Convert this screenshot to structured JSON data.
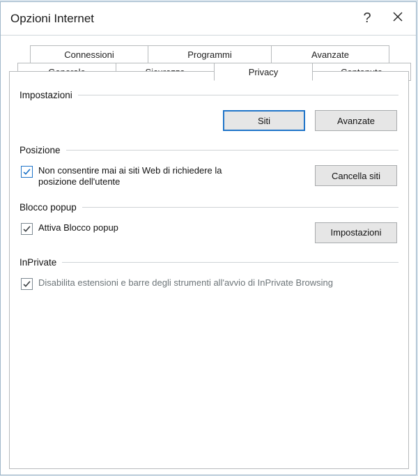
{
  "window": {
    "title": "Opzioni Internet"
  },
  "tabs": {
    "row1": {
      "connections": "Connessioni",
      "programs": "Programmi",
      "advanced": "Avanzate"
    },
    "row2": {
      "general": "Generale",
      "security": "Sicurezza",
      "privacy": "Privacy",
      "content": "Contenuto"
    },
    "active": "privacy"
  },
  "privacy": {
    "settings": {
      "heading": "Impostazioni",
      "sites_btn": "Siti",
      "advanced_btn": "Avanzate"
    },
    "location": {
      "heading": "Posizione",
      "never_allow_label": "Non consentire mai ai siti Web di richiedere la posizione dell'utente",
      "never_allow_checked": true,
      "clear_sites_btn": "Cancella siti"
    },
    "popup": {
      "heading": "Blocco popup",
      "enable_label": "Attiva Blocco popup",
      "enable_checked": true,
      "settings_btn": "Impostazioni"
    },
    "inprivate": {
      "heading": "InPrivate",
      "disable_ext_label": "Disabilita estensioni e barre degli strumenti all'avvio di InPrivate Browsing",
      "disable_ext_checked": true
    }
  },
  "colors": {
    "accent": "#1f74c9"
  }
}
